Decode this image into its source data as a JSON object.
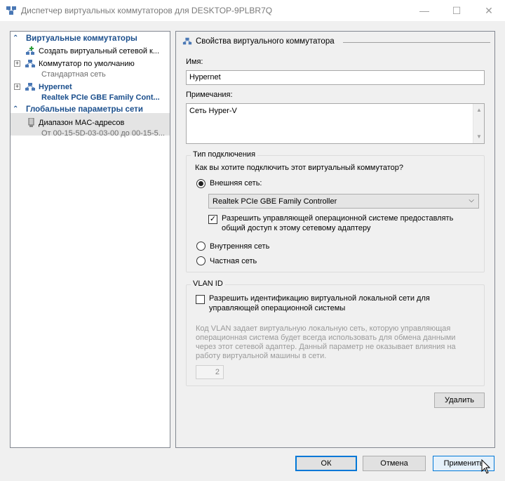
{
  "window": {
    "title": "Диспетчер виртуальных коммутаторов для DESKTOP-9PLBR7Q",
    "minimize_glyph": "—",
    "maximize_glyph": "☐",
    "close_glyph": "✕"
  },
  "tree": {
    "section_switches": "Виртуальные коммутаторы",
    "create_switch": "Создать виртуальный сетевой к...",
    "default_switch": "Коммутатор по умолчанию",
    "default_switch_sub": "Стандартная сеть",
    "hypernet": "Hypernet",
    "hypernet_sub": "Realtek PCIe GBE Family Cont...",
    "section_global": "Глобальные параметры сети",
    "mac_range": "Диапазон MAC-адресов",
    "mac_range_sub": "От 00-15-5D-03-03-00 до 00-15-5..."
  },
  "props": {
    "header": "Свойства виртуального коммутатора",
    "name_label": "Имя:",
    "name_value": "Hypernet",
    "notes_label": "Примечания:",
    "notes_value": "Сеть Hyper-V",
    "conn_group": "Тип подключения",
    "conn_question": "Как вы хотите подключить этот виртуальный коммутатор?",
    "external": "Внешняя сеть:",
    "adapter": "Realtek PCIe GBE Family Controller",
    "allow_mgmt_line1": "Разрешить управляющей операционной системе предоставлять",
    "allow_mgmt_line2": "общий доступ к этому сетевому адаптеру",
    "internal": "Внутренняя сеть",
    "private": "Частная сеть",
    "vlan_group": "VLAN ID",
    "vlan_check_line1": "Разрешить идентификацию виртуальной локальной сети для",
    "vlan_check_line2": "управляющей операционной системы",
    "vlan_help_line1": "Код VLAN задает виртуальную локальную сеть, которую управляющая",
    "vlan_help_line2": "операционная система будет всегда использовать для обмена данными",
    "vlan_help_line3": "через этот сетевой адаптер. Данный параметр не оказывает влияния на",
    "vlan_help_line4": "работу виртуальной машины в сети.",
    "vlan_value": "2",
    "remove": "Удалить"
  },
  "buttons": {
    "ok": "ОК",
    "cancel": "Отмена",
    "apply": "Применить"
  }
}
